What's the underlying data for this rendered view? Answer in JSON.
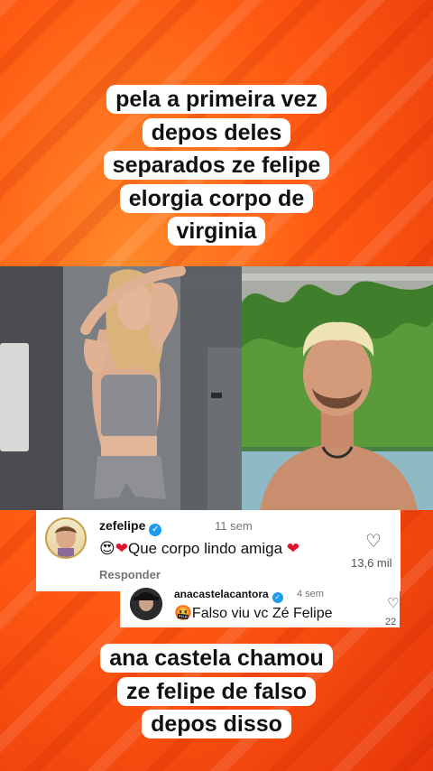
{
  "caption_top": {
    "lines": [
      "pela a primeira vez",
      "depos deles",
      "separados ze felipe",
      "elorgia corpo de",
      "virginia"
    ]
  },
  "caption_bottom": {
    "lines": [
      "ana castela chamou",
      "ze felipe de falso",
      "depos disso"
    ]
  },
  "comment1": {
    "username": "zefelipe",
    "verified_glyph": "✓",
    "time": "11 sem",
    "emoji_prefix": "😍",
    "heart_prefix": "❤",
    "text": "Que corpo lindo amiga",
    "heart_suffix": "❤",
    "reply_label": "Responder",
    "like_icon": "♡",
    "like_count": "13,6 mil"
  },
  "comment2": {
    "username": "anacastelacantora",
    "verified_glyph": "✓",
    "time": "4 sem",
    "emoji_prefix": "🤬",
    "text": "Falso viu vc Zé Felipe",
    "like_icon": "♡",
    "like_count": "22"
  },
  "colors": {
    "background": "#ff5a14",
    "verified": "#1d9bf0",
    "heart": "#e0142c"
  }
}
